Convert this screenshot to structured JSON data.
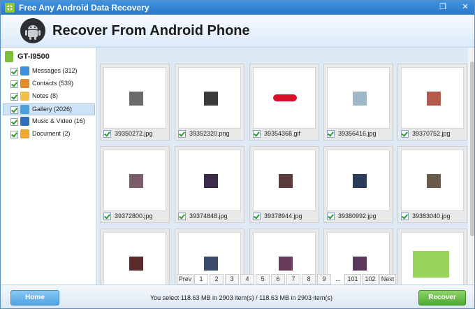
{
  "window": {
    "title": "Free Any Android Data Recovery",
    "minimize_glyph": "❒",
    "close_glyph": "✕"
  },
  "header": {
    "title": "Recover From Android Phone"
  },
  "sidebar": {
    "device": "GT-I9500",
    "items": [
      {
        "label": "Messages (312)",
        "icon": "messages-icon",
        "color": "#3b8fe0"
      },
      {
        "label": "Contacts (539)",
        "icon": "contacts-icon",
        "color": "#e68a2e"
      },
      {
        "label": "Notes (8)",
        "icon": "notes-icon",
        "color": "#f2c04a"
      },
      {
        "label": "Gallery (2026)",
        "icon": "gallery-icon",
        "color": "#4aa3e0"
      },
      {
        "label": "Music & Video (16)",
        "icon": "music-video-icon",
        "color": "#2f6fc1"
      },
      {
        "label": "Document (2)",
        "icon": "document-icon",
        "color": "#f0a830"
      }
    ],
    "selected_index": 3
  },
  "gallery": {
    "files": [
      "39350272.jpg",
      "39352320.png",
      "39354368.gif",
      "39356416.jpg",
      "39370752.jpg",
      "39372800.jpg",
      "39374848.jpg",
      "39378944.jpg",
      "39380992.jpg",
      "39383040.jpg",
      "",
      "",
      "",
      "",
      ""
    ]
  },
  "pagination": {
    "prev": "Prev",
    "pages": [
      "1",
      "2",
      "3",
      "4",
      "5",
      "6",
      "7",
      "8",
      "9"
    ],
    "ellipsis": "...",
    "last_pages": [
      "101",
      "102"
    ],
    "next": "Next",
    "current": "1"
  },
  "footer": {
    "home_label": "Home",
    "status": "You select 118.63 MB in 2903 item(s) / 118.63 MB in 2903 item(s)",
    "recover_label": "Recover"
  },
  "colors": {
    "title_bar": "#2a78c8",
    "accent": "#4fa3e3",
    "recover": "#4daa2f"
  }
}
